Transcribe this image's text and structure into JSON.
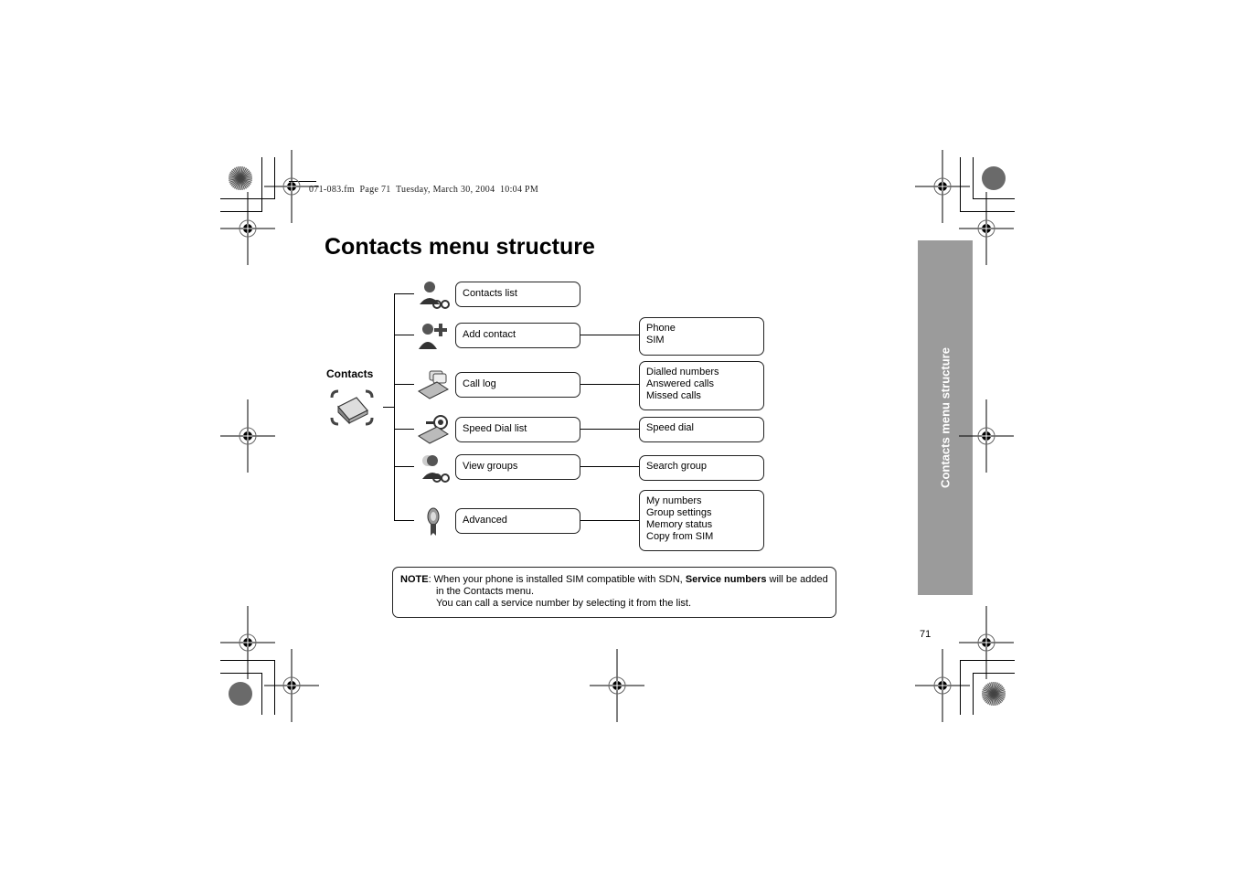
{
  "header_line": "071-083.fm  Page 71  Tuesday, March 30, 2004  10:04 PM",
  "title": "Contacts menu structure",
  "root": {
    "label": "Contacts",
    "icon": "phone-book-icon"
  },
  "menu": [
    {
      "label": "Contacts list",
      "icon": "contacts-list-icon",
      "submenu": []
    },
    {
      "label": "Add contact",
      "icon": "add-contact-icon",
      "submenu": [
        "Phone",
        "SIM"
      ]
    },
    {
      "label": "Call log",
      "icon": "call-log-icon",
      "submenu": [
        "Dialled numbers",
        "Answered calls",
        "Missed calls"
      ]
    },
    {
      "label": "Speed Dial list",
      "icon": "speed-dial-icon",
      "submenu": [
        "Speed dial"
      ]
    },
    {
      "label": "View groups",
      "icon": "view-groups-icon",
      "submenu": [
        "Search group"
      ]
    },
    {
      "label": "Advanced",
      "icon": "advanced-icon",
      "submenu": [
        "My numbers",
        "Group settings",
        "Memory status",
        "Copy from SIM"
      ]
    }
  ],
  "note": {
    "label": "NOTE",
    "text_before": ": When your phone is installed SIM compatible with SDN, ",
    "bold": "Service numbers",
    "text_after": " will be added",
    "line2": "in the Contacts menu.",
    "line3": "You can call a service number by selecting it from the list."
  },
  "side_tab": "Contacts menu structure",
  "page_number": "71",
  "colors": {
    "tab_bg": "#9b9b9b",
    "tab_text": "#ffffff"
  }
}
